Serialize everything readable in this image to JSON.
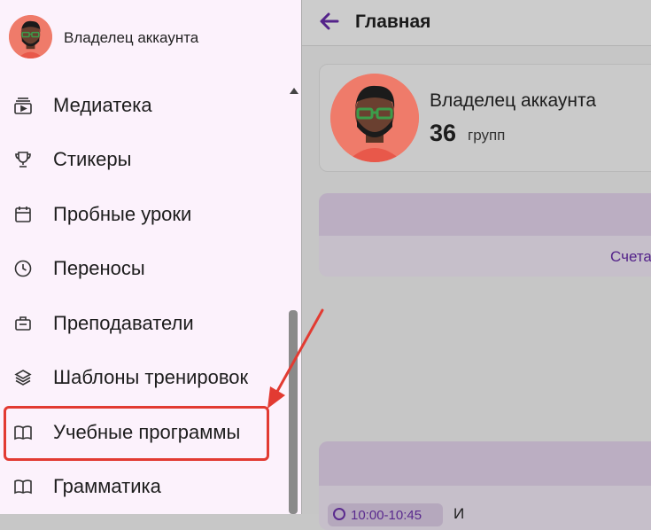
{
  "sidebar": {
    "account_name": "Владелец аккаунта",
    "items": [
      {
        "label": "Медиатека",
        "icon": "media-library-icon"
      },
      {
        "label": "Стикеры",
        "icon": "trophy-icon"
      },
      {
        "label": "Пробные уроки",
        "icon": "calendar-icon"
      },
      {
        "label": "Переносы",
        "icon": "clock-icon"
      },
      {
        "label": "Преподаватели",
        "icon": "id-badge-icon"
      },
      {
        "label": "Шаблоны тренировок",
        "icon": "layers-icon"
      },
      {
        "label": "Учебные программы",
        "icon": "open-book-icon"
      },
      {
        "label": "Грамматика",
        "icon": "open-book-icon"
      }
    ]
  },
  "header": {
    "title": "Главная"
  },
  "profile": {
    "name": "Владелец аккаунта",
    "groups_count": "36",
    "groups_label": "групп"
  },
  "panel": {
    "link_text": "Счета"
  },
  "lesson": {
    "time": "10:00-10:45",
    "title_start": "И"
  },
  "colors": {
    "accent": "#54238a",
    "highlight": "#e23b32",
    "avatar_bg": "#ef7b6a"
  }
}
